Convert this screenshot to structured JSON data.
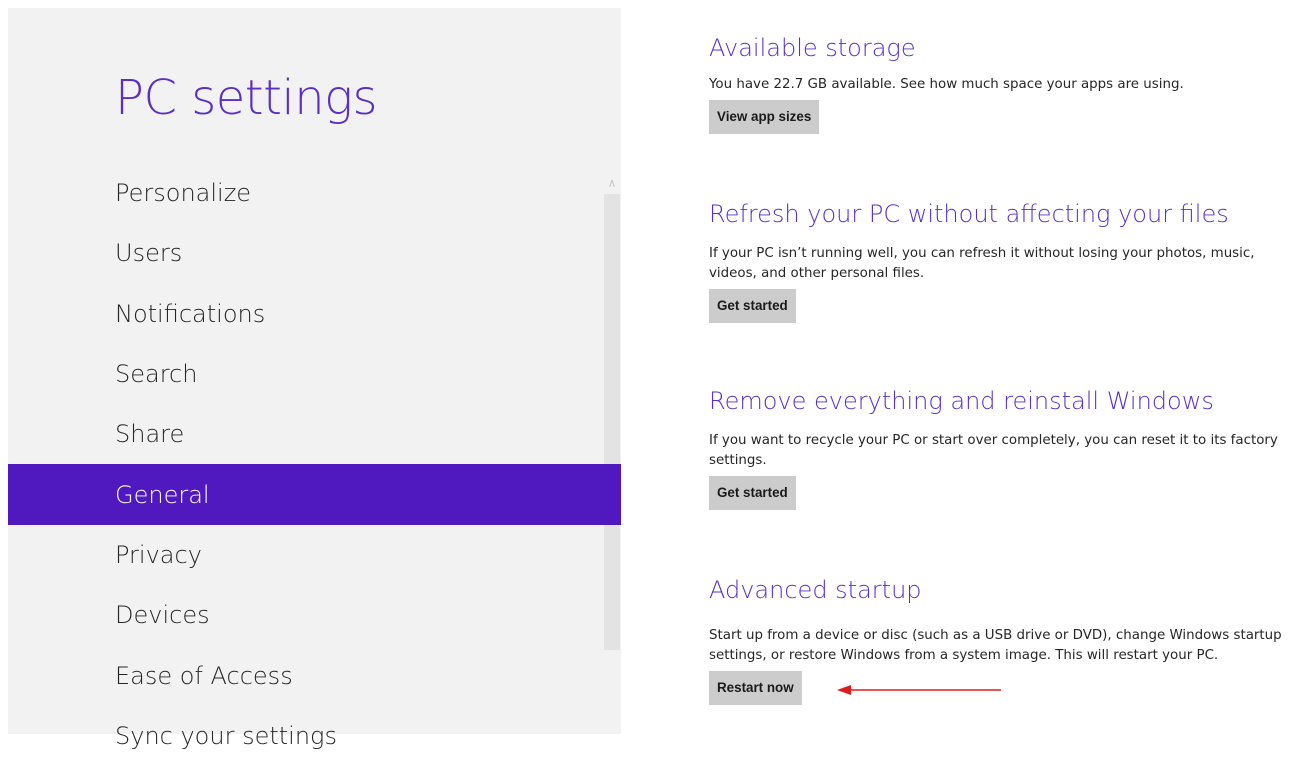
{
  "sidebar": {
    "title": "PC settings",
    "items": [
      {
        "label": "Personalize"
      },
      {
        "label": "Users"
      },
      {
        "label": "Notifications"
      },
      {
        "label": "Search"
      },
      {
        "label": "Share"
      },
      {
        "label": "General",
        "selected": true
      },
      {
        "label": "Privacy"
      },
      {
        "label": "Devices"
      },
      {
        "label": "Ease of Access"
      },
      {
        "label": "Sync your settings"
      }
    ],
    "scroll_icon": "chevron-up-icon"
  },
  "main": {
    "sections": [
      {
        "heading": "Available storage",
        "description": "You have 22.7 GB available. See how much space your apps are using.",
        "button_label": "View app sizes"
      },
      {
        "heading": "Refresh your PC without affecting your files",
        "description": "If your PC isn’t running well, you can refresh it without losing your photos, music, videos, and other personal files.",
        "button_label": "Get started"
      },
      {
        "heading": "Remove everything and reinstall Windows",
        "description": "If you want to recycle your PC or start over completely, you can reset it to its factory settings.",
        "button_label": "Get started"
      },
      {
        "heading": "Advanced startup",
        "description": "Start up from a device or disc (such as a USB drive or DVD), change Windows startup settings, or restore Windows from a system image. This will restart your PC.",
        "button_label": "Restart now"
      }
    ]
  },
  "colors": {
    "accent": "#5019bf",
    "heading": "#5b2fc6",
    "annotation_arrow": "#e01b1b"
  }
}
